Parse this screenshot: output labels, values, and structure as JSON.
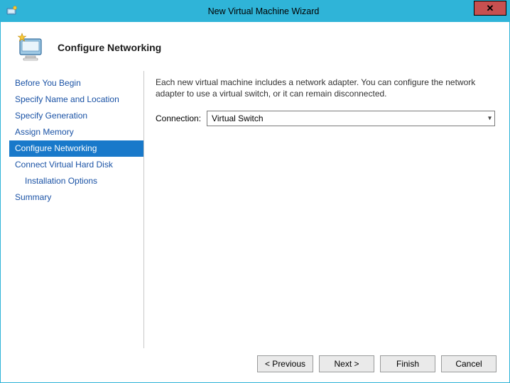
{
  "window": {
    "title": "New Virtual Machine Wizard",
    "close_glyph": "✕"
  },
  "header": {
    "page_title": "Configure Networking"
  },
  "sidebar": {
    "items": [
      {
        "label": "Before You Begin",
        "selected": false,
        "sub": false
      },
      {
        "label": "Specify Name and Location",
        "selected": false,
        "sub": false
      },
      {
        "label": "Specify Generation",
        "selected": false,
        "sub": false
      },
      {
        "label": "Assign Memory",
        "selected": false,
        "sub": false
      },
      {
        "label": "Configure Networking",
        "selected": true,
        "sub": false
      },
      {
        "label": "Connect Virtual Hard Disk",
        "selected": false,
        "sub": false
      },
      {
        "label": "Installation Options",
        "selected": false,
        "sub": true
      },
      {
        "label": "Summary",
        "selected": false,
        "sub": false
      }
    ]
  },
  "content": {
    "description": "Each new virtual machine includes a network adapter. You can configure the network adapter to use a virtual switch, or it can remain disconnected.",
    "connection_label": "Connection:",
    "connection_value": "Virtual Switch"
  },
  "footer": {
    "previous": "< Previous",
    "next": "Next >",
    "finish": "Finish",
    "cancel": "Cancel"
  }
}
